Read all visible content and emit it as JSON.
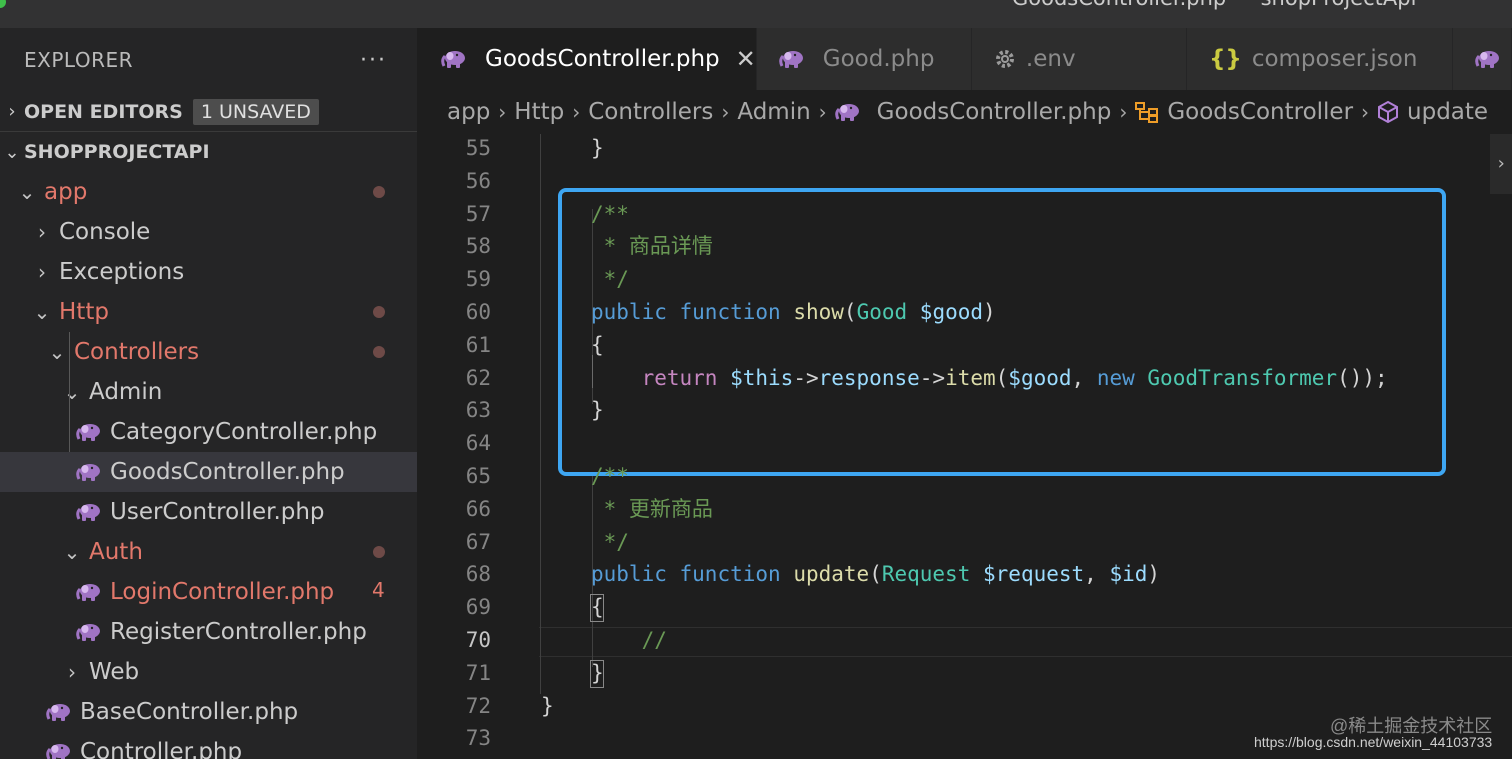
{
  "window": {
    "title": "GoodsController.php — shopProjectApi"
  },
  "sidebar": {
    "header": "EXPLORER",
    "more": "···",
    "open_editors": {
      "label": "OPEN EDITORS",
      "badge": "1 UNSAVED"
    },
    "project": {
      "label": "SHOPPROJECTAPI"
    },
    "tree": [
      {
        "label": "app",
        "type": "folder",
        "open": true,
        "modified": true
      },
      {
        "label": "Console",
        "type": "folder",
        "open": false
      },
      {
        "label": "Exceptions",
        "type": "folder",
        "open": false
      },
      {
        "label": "Http",
        "type": "folder",
        "open": true,
        "modified": true
      },
      {
        "label": "Controllers",
        "type": "folder",
        "open": true,
        "modified": true
      },
      {
        "label": "Admin",
        "type": "folder",
        "open": true
      },
      {
        "label": "CategoryController.php",
        "type": "php"
      },
      {
        "label": "GoodsController.php",
        "type": "php",
        "selected": true
      },
      {
        "label": "UserController.php",
        "type": "php"
      },
      {
        "label": "Auth",
        "type": "folder",
        "open": true,
        "modified": true
      },
      {
        "label": "LoginController.php",
        "type": "php",
        "modified": true,
        "problems": "4"
      },
      {
        "label": "RegisterController.php",
        "type": "php"
      },
      {
        "label": "Web",
        "type": "folder",
        "open": false
      },
      {
        "label": "BaseController.php",
        "type": "php"
      },
      {
        "label": "Controller.php",
        "type": "php"
      }
    ]
  },
  "tabs": [
    {
      "label": "GoodsController.php",
      "icon": "php-elephant-icon",
      "active": true,
      "close": "✕"
    },
    {
      "label": "Good.php",
      "icon": "php-elephant-icon"
    },
    {
      "label": ".env",
      "icon": "gear-icon"
    },
    {
      "label": "composer.json",
      "icon": "braces-icon",
      "glyph": "{}"
    }
  ],
  "breadcrumb": {
    "items": [
      "app",
      "Http",
      "Controllers",
      "Admin",
      "GoodsController.php",
      "GoodsController",
      "update"
    ],
    "icons": {
      "GoodsController.php": "php-elephant-icon",
      "GoodsController": "class-icon",
      "update": "method-cube-icon"
    }
  },
  "editor": {
    "current_line": "70",
    "lines": [
      {
        "n": "55",
        "code": [
          {
            "t": "}",
            "c": "punc"
          }
        ]
      },
      {
        "n": "56",
        "code": []
      },
      {
        "n": "57",
        "code": [
          {
            "t": "/**",
            "c": "comment"
          }
        ]
      },
      {
        "n": "58",
        "code": [
          {
            "t": " * 商品详情",
            "c": "comment"
          }
        ]
      },
      {
        "n": "59",
        "code": [
          {
            "t": " */",
            "c": "comment"
          }
        ]
      },
      {
        "n": "60",
        "code": [
          {
            "t": "public",
            "c": "kw"
          },
          {
            "t": " ",
            "c": "punc"
          },
          {
            "t": "function",
            "c": "kw"
          },
          {
            "t": " ",
            "c": "punc"
          },
          {
            "t": "show",
            "c": "fn"
          },
          {
            "t": "(",
            "c": "punc"
          },
          {
            "t": "Good",
            "c": "type"
          },
          {
            "t": " ",
            "c": "punc"
          },
          {
            "t": "$good",
            "c": "var"
          },
          {
            "t": ")",
            "c": "punc"
          }
        ]
      },
      {
        "n": "61",
        "code": [
          {
            "t": "{",
            "c": "punc"
          }
        ]
      },
      {
        "n": "62",
        "code": [
          {
            "t": "    ",
            "c": "punc"
          },
          {
            "t": "return",
            "c": "kw2"
          },
          {
            "t": " ",
            "c": "punc"
          },
          {
            "t": "$this",
            "c": "var"
          },
          {
            "t": "->",
            "c": "punc"
          },
          {
            "t": "response",
            "c": "var"
          },
          {
            "t": "->",
            "c": "punc"
          },
          {
            "t": "item",
            "c": "fn"
          },
          {
            "t": "(",
            "c": "punc"
          },
          {
            "t": "$good",
            "c": "var"
          },
          {
            "t": ", ",
            "c": "punc"
          },
          {
            "t": "new",
            "c": "kw"
          },
          {
            "t": " ",
            "c": "punc"
          },
          {
            "t": "GoodTransformer",
            "c": "type"
          },
          {
            "t": "());",
            "c": "punc"
          }
        ]
      },
      {
        "n": "63",
        "code": [
          {
            "t": "}",
            "c": "punc"
          }
        ]
      },
      {
        "n": "64",
        "code": []
      },
      {
        "n": "65",
        "code": [
          {
            "t": "/**",
            "c": "comment"
          }
        ]
      },
      {
        "n": "66",
        "code": [
          {
            "t": " * 更新商品",
            "c": "comment"
          }
        ]
      },
      {
        "n": "67",
        "code": [
          {
            "t": " */",
            "c": "comment"
          }
        ]
      },
      {
        "n": "68",
        "code": [
          {
            "t": "public",
            "c": "kw"
          },
          {
            "t": " ",
            "c": "punc"
          },
          {
            "t": "function",
            "c": "kw"
          },
          {
            "t": " ",
            "c": "punc"
          },
          {
            "t": "update",
            "c": "fn"
          },
          {
            "t": "(",
            "c": "punc"
          },
          {
            "t": "Request",
            "c": "type"
          },
          {
            "t": " ",
            "c": "punc"
          },
          {
            "t": "$request",
            "c": "var"
          },
          {
            "t": ", ",
            "c": "punc"
          },
          {
            "t": "$id",
            "c": "var"
          },
          {
            "t": ")",
            "c": "punc"
          }
        ]
      },
      {
        "n": "69",
        "code": [
          {
            "t": "{",
            "c": "punc"
          }
        ]
      },
      {
        "n": "70",
        "code": [
          {
            "t": "    ",
            "c": "punc"
          },
          {
            "t": "//",
            "c": "comment"
          }
        ]
      },
      {
        "n": "71",
        "code": [
          {
            "t": "}",
            "c": "punc"
          }
        ]
      },
      {
        "n": "72",
        "code": [
          {
            "t": "}",
            "c": "punc"
          }
        ]
      },
      {
        "n": "73",
        "code": []
      }
    ]
  },
  "watermark": {
    "line1": "@稀土掘金技术社区",
    "line2": "https://blog.csdn.net/weixin_44103733"
  },
  "colors": {
    "accent_box": "#3ea6f2",
    "modified": "#e2786b",
    "php_icon": "#a074c4"
  }
}
